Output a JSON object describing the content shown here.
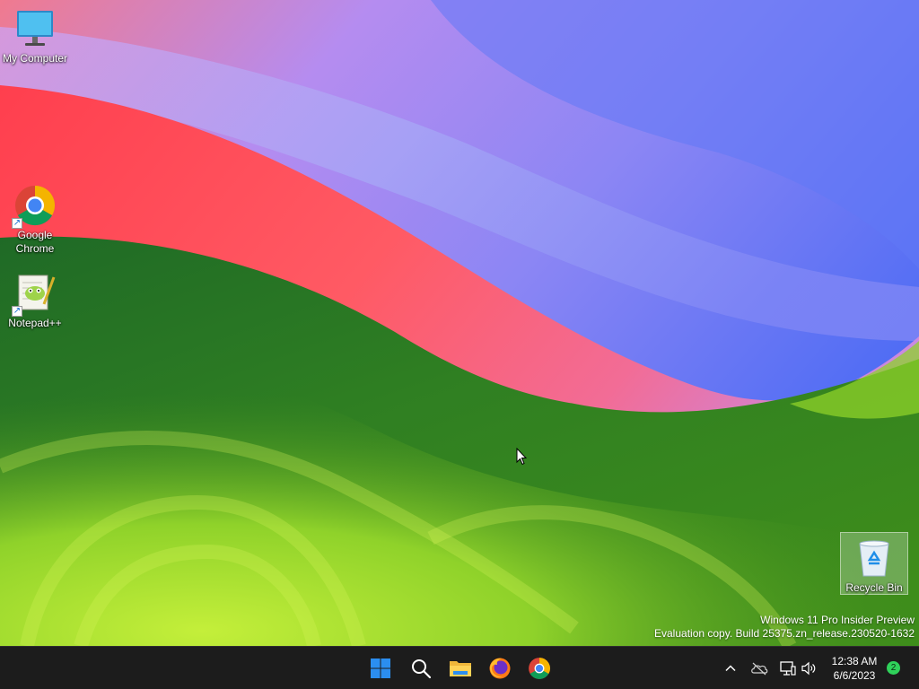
{
  "desktop": {
    "icons": [
      {
        "label": "My Computer"
      },
      {
        "label": "Google Chrome"
      },
      {
        "label": "Notepad++"
      },
      {
        "label": "Recycle Bin"
      }
    ]
  },
  "watermark": {
    "line1": "Windows 11 Pro Insider Preview",
    "line2": "Evaluation copy. Build 25375.zn_release.230520-1632"
  },
  "taskbar": {
    "pinned": [
      {
        "icon": "windows-start-icon"
      },
      {
        "icon": "search-icon"
      },
      {
        "icon": "file-explorer-icon"
      },
      {
        "icon": "firefox-icon"
      },
      {
        "icon": "chrome-icon"
      }
    ],
    "tray": {
      "icons": [
        "chevron-up-icon",
        "onedrive-offline-icon",
        "network-icon",
        "volume-icon"
      ],
      "time": "12:38 AM",
      "date": "6/6/2023",
      "notification_count": "2"
    }
  },
  "colors": {
    "taskbar_bg": "#1c1c1c",
    "windows_blue": "#2b8ef0",
    "notification_green": "#2fd15a"
  }
}
